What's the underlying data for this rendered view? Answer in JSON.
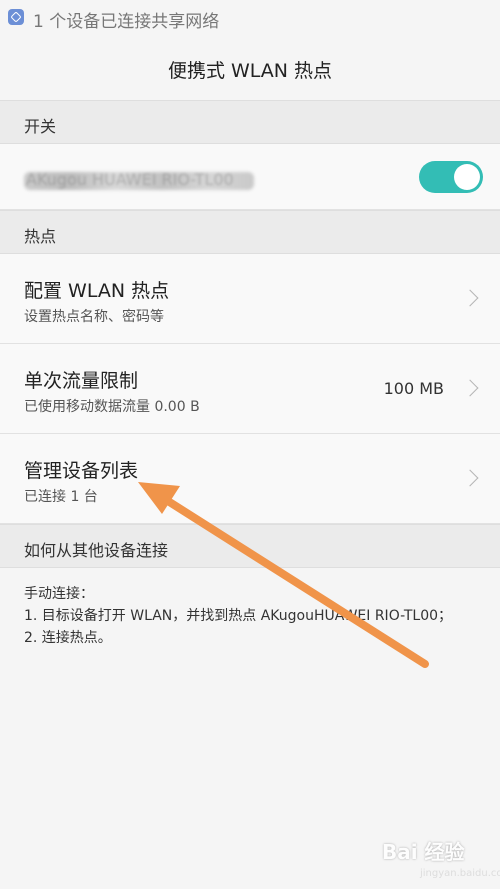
{
  "status_bar": {
    "notification": "1 个设备已连接共享网络"
  },
  "header": {
    "title": "便携式 WLAN 热点"
  },
  "sections": {
    "switch_label": "开关",
    "hotspot_label": "热点",
    "howto_label": "如何从其他设备连接"
  },
  "switch_row": {
    "ssid_obscured": "AKugou HUAWEI RIO-TL00",
    "toggle_state": "on"
  },
  "rows": {
    "configure": {
      "title": "配置 WLAN 热点",
      "subtitle": "设置热点名称、密码等"
    },
    "data_limit": {
      "title": "单次流量限制",
      "subtitle": "已使用移动数据流量 0.00 B",
      "value": "100 MB"
    },
    "devices": {
      "title": "管理设备列表",
      "subtitle": "已连接 1 台"
    }
  },
  "howto": {
    "line1": "手动连接：",
    "line2": "1. 目标设备打开 WLAN，并找到热点 AKugouHUAWEI RIO-TL00；",
    "line3": "2. 连接热点。"
  },
  "watermark": {
    "text": "Bai 经验",
    "sub": "jingyan.baidu.com"
  },
  "colors": {
    "accent": "#33bdb5",
    "annotation_arrow": "#f0944a"
  }
}
